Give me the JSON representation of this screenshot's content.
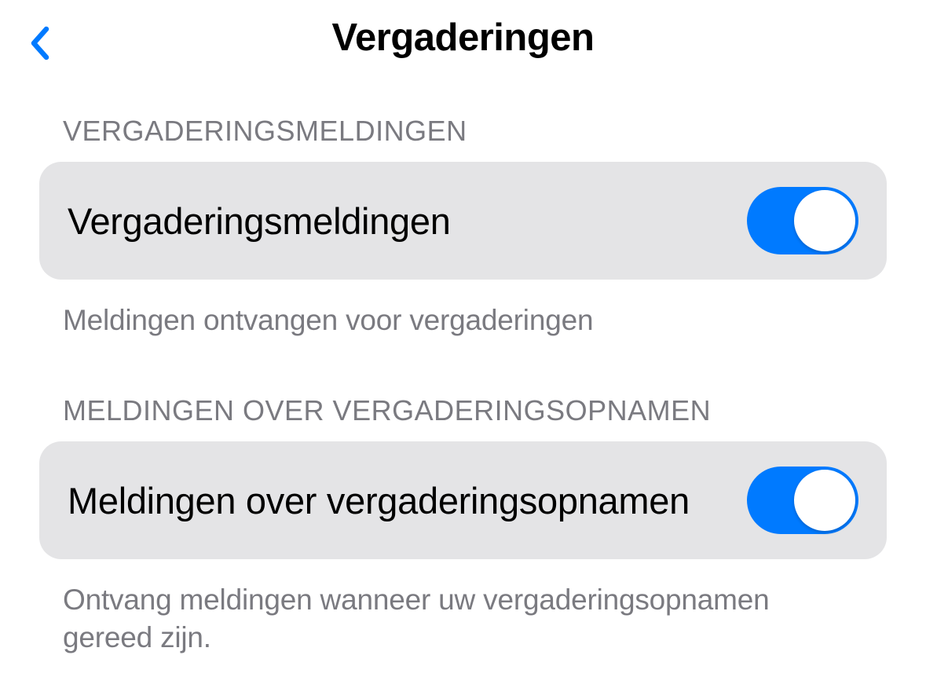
{
  "header": {
    "title": "Vergaderingen"
  },
  "sections": [
    {
      "header": "VERGADERINGSMELDINGEN",
      "row_label": "Vergaderingsmeldingen",
      "toggle_on": true,
      "footer": "Meldingen ontvangen voor vergaderingen"
    },
    {
      "header": "MELDINGEN OVER VERGADERINGSOPNAMEN",
      "row_label": "Meldingen over vergaderingsopnamen",
      "toggle_on": true,
      "footer": "Ontvang meldingen wanneer uw vergaderingsopnamen gereed zijn."
    }
  ],
  "colors": {
    "accent": "#007aff",
    "row_bg": "#e4e4e6",
    "secondary_text": "#7a7a80"
  }
}
